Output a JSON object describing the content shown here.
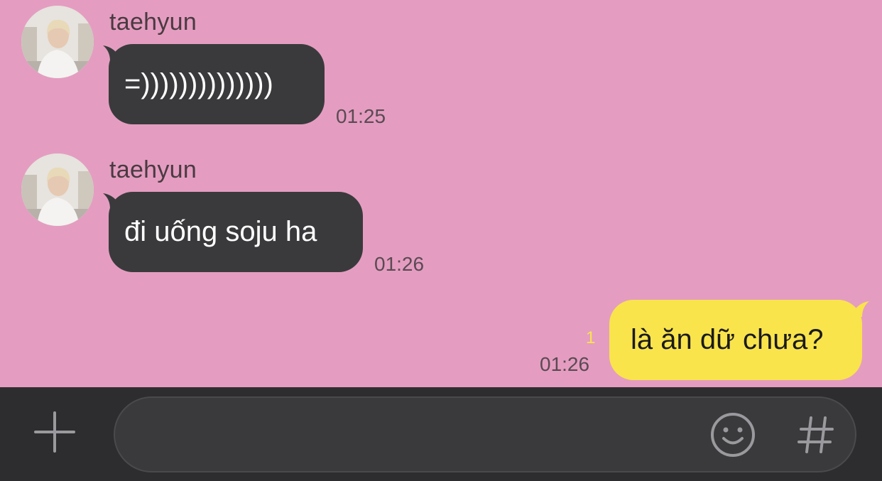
{
  "messages": [
    {
      "sender": "taehyun",
      "text": "=))))))))))))))",
      "time": "01:25",
      "direction": "incoming",
      "avatar": "profile-photo"
    },
    {
      "sender": "taehyun",
      "text": "đi uống soju ha",
      "time": "01:26",
      "direction": "incoming",
      "avatar": "profile-photo"
    },
    {
      "text": "là ăn dữ chưa?",
      "time": "01:26",
      "unread_count": "1",
      "direction": "outgoing"
    }
  ],
  "composer": {
    "value": "",
    "placeholder": "",
    "plus_icon": "plus-icon",
    "emoji_icon": "smiley-icon",
    "hash_icon": "hash-icon"
  },
  "colors": {
    "background": "#e49dc0",
    "incoming_bubble": "#3a3a3c",
    "outgoing_bubble": "#f9e44c",
    "input_bar": "#2d2d2f"
  }
}
